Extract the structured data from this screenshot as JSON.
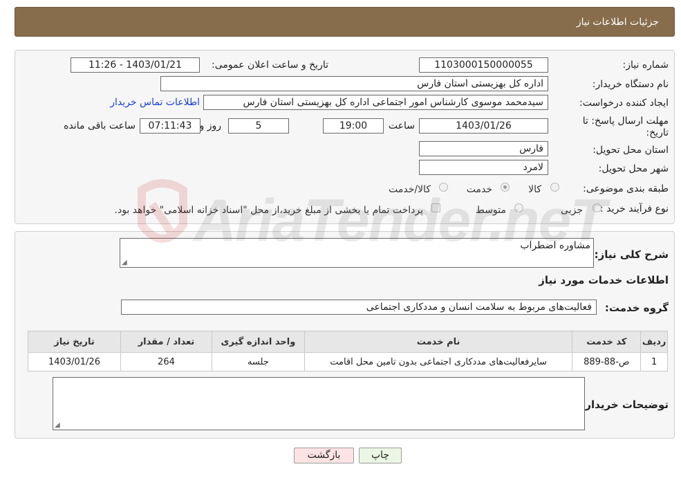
{
  "header": {
    "title": "جزئیات اطلاعات نیاز"
  },
  "form": {
    "need_number_label": "شماره نیاز:",
    "need_number": "1103000150000055",
    "announce_label": "تاریخ و ساعت اعلان عمومی:",
    "announce_value": "1403/01/21 - 11:26",
    "buyer_org_label": "نام دستگاه خریدار:",
    "buyer_org": "اداره کل بهزیستی استان فارس",
    "creator_label": "ایجاد کننده درخواست:",
    "creator": "سیدمحمد موسوی کارشناس امور اجتماعی اداره کل بهزیستی استان فارس",
    "contact_link": "اطلاعات تماس خریدار",
    "deadline_label_1": "مهلت ارسال پاسخ: تا",
    "deadline_label_2": "تاریخ:",
    "deadline_date": "1403/01/26",
    "time_label": "ساعت",
    "deadline_time": "19:00",
    "days": "5",
    "days_label": "روز و",
    "remaining_time": "07:11:43",
    "remaining_label": "ساعت باقی مانده",
    "province_label": "استان محل تحویل:",
    "province": "فارس",
    "city_label": "شهر محل تحویل:",
    "city": "لامرد",
    "category_label": "طبقه بندی موضوعی:",
    "category_options": [
      "کالا",
      "خدمت",
      "کالا/خدمت"
    ],
    "category_selected": "خدمت",
    "process_label": "نوع فرآیند خرید :",
    "process_options": [
      "جزیی",
      "متوسط"
    ],
    "payment_note": "پرداخت تمام یا بخشی از مبلغ خرید،از محل \"اسناد خزانه اسلامی\" خواهد بود."
  },
  "details": {
    "summary_label": "شرح کلی نیاز:",
    "summary": "مشاوره اضطراب",
    "services_title": "اطلاعات خدمات مورد نیاز",
    "group_label": "گروه خدمت:",
    "group": "فعالیت‌های مربوط به سلامت انسان و مددکاری اجتماعی",
    "table": {
      "headers": [
        "ردیف",
        "کد خدمت",
        "نام خدمت",
        "واحد اندازه گیری",
        "تعداد / مقدار",
        "تاریخ نیاز"
      ],
      "rows": [
        [
          "1",
          "ص-88-889",
          "سایرفعالیت‌های مددکاری اجتماعی بدون تامین محل اقامت",
          "جلسه",
          "264",
          "1403/01/26"
        ]
      ]
    },
    "buyer_notes_label": "توضیحات خریدار:",
    "buyer_notes": ""
  },
  "buttons": {
    "print": "چاپ",
    "back": "بازگشت"
  },
  "watermark": "AriaTender.neT",
  "colors": {
    "header_bg": "#876d4b",
    "link": "#1a3fd6",
    "back_button": "#fde3e3",
    "print_button": "#e9f7e4"
  }
}
